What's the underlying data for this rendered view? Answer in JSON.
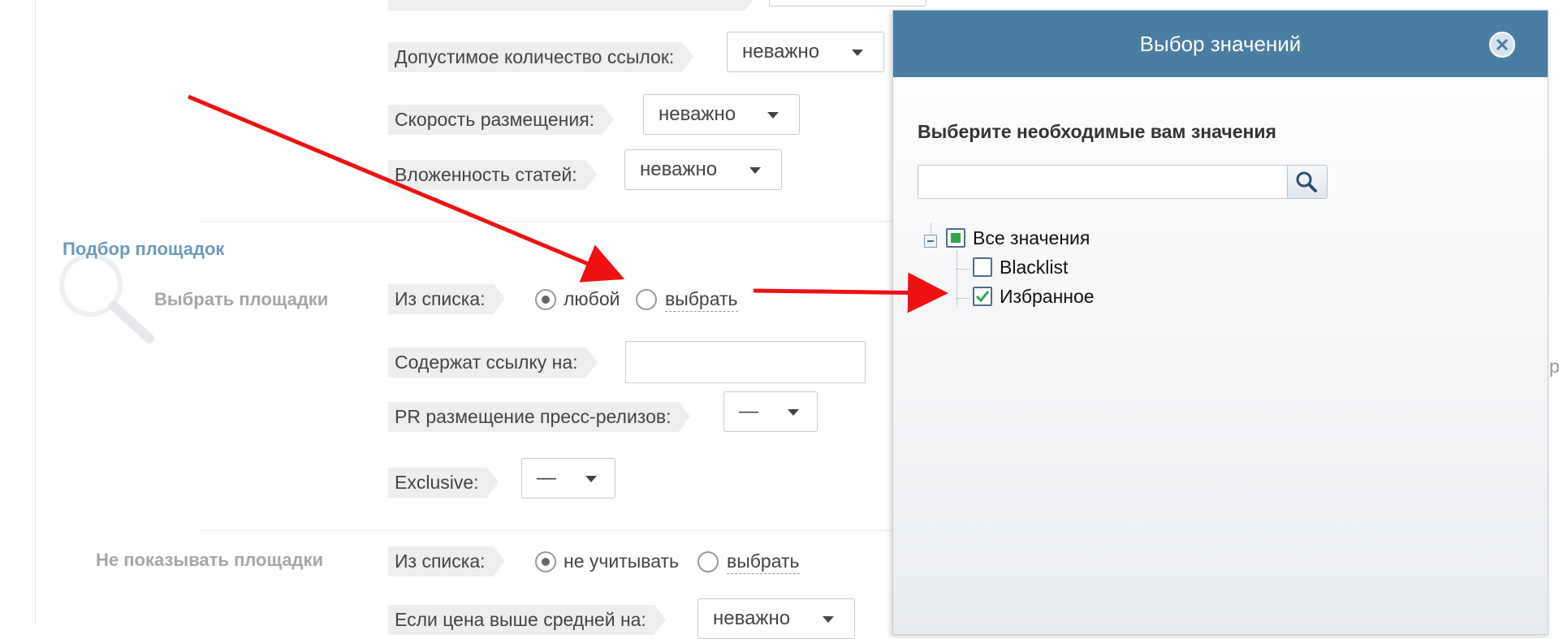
{
  "form": {
    "links_count": {
      "label": "Допустимое количество ссылок:",
      "value": "неважно"
    },
    "placement_speed": {
      "label": "Скорость размещения:",
      "value": "неважно"
    },
    "articles_nesting": {
      "label": "Вложенность статей:",
      "value": "неважно"
    },
    "section_title": "Подбор площадок",
    "select_sites": {
      "title": "Выбрать площадки",
      "from_list_label": "Из списка:",
      "option_any": "любой",
      "option_choose": "выбрать",
      "selected": "любой"
    },
    "contains_link": {
      "label": "Содержат ссылку на:",
      "value": ""
    },
    "pr_press": {
      "label": "PR размещение пресс-релизов:",
      "value": "—"
    },
    "exclusive": {
      "label": "Exclusive:",
      "value": "—"
    },
    "hide_sites": {
      "title": "Не показывать площадки",
      "from_list_label": "Из списка:",
      "option_ignore": "не учитывать",
      "option_choose": "выбрать",
      "selected": "не учитывать"
    },
    "price_above": {
      "label": "Если цена выше средней на:",
      "value": "неважно"
    }
  },
  "modal": {
    "title": "Выбор значений",
    "subtitle": "Выберите необходимые вам значения",
    "search": {
      "value": "",
      "placeholder": ""
    },
    "tree": {
      "root": {
        "label": "Все значения",
        "state": "partial",
        "expanded": true
      },
      "children": [
        {
          "label": "Blacklist",
          "checked": false
        },
        {
          "label": "Избранное",
          "checked": true
        }
      ]
    }
  },
  "colors": {
    "modal_header": "#4a7da1",
    "section_title": "#6b9bbf",
    "arrow": "#ee1111",
    "check": "#2fa64a"
  },
  "icons": [
    "search-icon",
    "close-icon",
    "magnifier-watermark-icon",
    "tree-collapse-icon",
    "arrow-annotation"
  ]
}
